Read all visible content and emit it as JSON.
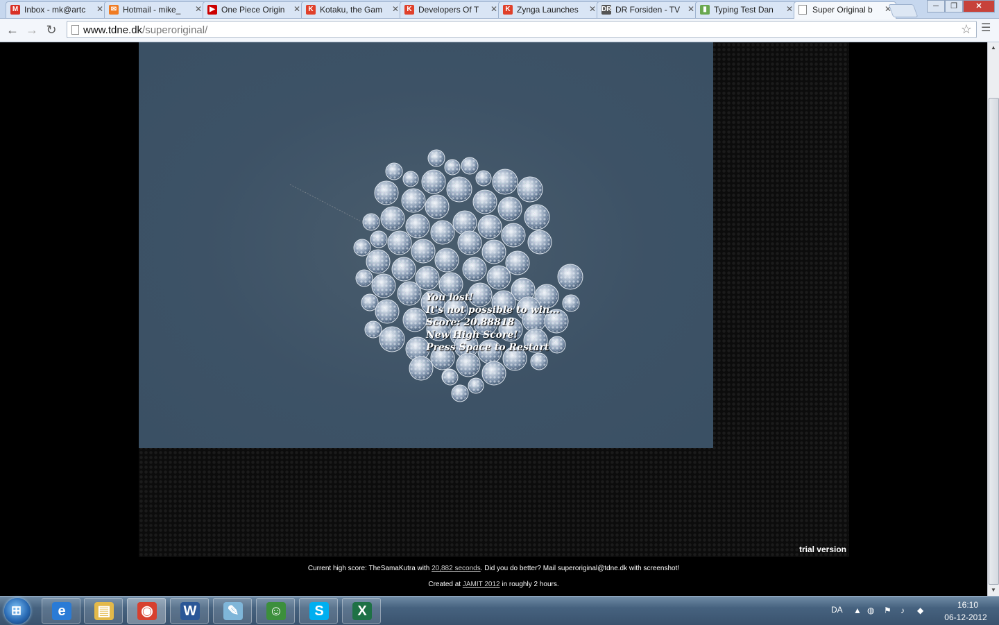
{
  "browser": {
    "tabs": [
      {
        "title": "Inbox - mk@artc",
        "icon": "gmail-icon",
        "color": "#d93025",
        "glyph": "M",
        "active": false
      },
      {
        "title": "Hotmail - mike_",
        "icon": "hotmail-icon",
        "color": "#f07b22",
        "glyph": "✉",
        "active": false
      },
      {
        "title": "One Piece Origin",
        "icon": "youtube-icon",
        "color": "#cc0000",
        "glyph": "▶",
        "active": false
      },
      {
        "title": "Kotaku, the Gam",
        "icon": "kotaku-icon",
        "color": "#e0402a",
        "glyph": "K",
        "active": false
      },
      {
        "title": "Developers Of T",
        "icon": "kotaku-icon",
        "color": "#e0402a",
        "glyph": "K",
        "active": false
      },
      {
        "title": "Zynga Launches",
        "icon": "kotaku-icon",
        "color": "#e0402a",
        "glyph": "K",
        "active": false
      },
      {
        "title": "DR Forsiden - TV",
        "icon": "dr-icon",
        "color": "#555555",
        "glyph": "DR",
        "active": false
      },
      {
        "title": "Typing Test Dan",
        "icon": "chart-icon",
        "color": "#6aa84f",
        "glyph": "▮",
        "active": false
      },
      {
        "title": "Super Original b",
        "icon": "page-icon",
        "color": "#ffffff",
        "glyph": "",
        "active": true
      }
    ],
    "window_buttons": {
      "minimize": "─",
      "maximize": "❐",
      "close": "✕"
    },
    "toolbar": {
      "back": "←",
      "forward": "→",
      "reload": "↻",
      "menu": "☰",
      "star": "☆"
    },
    "url": {
      "host": "www.tdne.dk",
      "path": "/superoriginal/"
    }
  },
  "game": {
    "overlay_lines": [
      "You lost!",
      "It's not possible to win...",
      "Score: 20.88818",
      "New High Score!",
      "Press Space to Restart"
    ],
    "colors": {
      "background": "#3d5266",
      "frame": "#0c0c0c"
    }
  },
  "page": {
    "trial_label": "trial version",
    "footer1": {
      "prefix": "Current high score: TheSamaKutra with ",
      "link": "20,882 seconds",
      "suffix": ". Did you do better? Mail superoriginal@tdne.dk with screenshot!"
    },
    "footer2": {
      "prefix": "Created at ",
      "link": "JAMIT 2012",
      "suffix": " in roughly 2 hours."
    }
  },
  "taskbar": {
    "start_glyph": "⊞",
    "apps": [
      {
        "name": "internet-explorer",
        "glyph": "e",
        "color": "#2a7bd6",
        "active": false
      },
      {
        "name": "file-explorer",
        "glyph": "▤",
        "color": "#e3b94a",
        "active": false
      },
      {
        "name": "chrome",
        "glyph": "◉",
        "color": "#d7402f",
        "active": true
      },
      {
        "name": "word",
        "glyph": "W",
        "color": "#2b5797",
        "active": false
      },
      {
        "name": "notes",
        "glyph": "✎",
        "color": "#7fb6d9",
        "active": false
      },
      {
        "name": "messenger",
        "glyph": "☺",
        "color": "#3c8f3c",
        "active": false
      },
      {
        "name": "skype",
        "glyph": "S",
        "color": "#00aff0",
        "active": false
      },
      {
        "name": "excel",
        "glyph": "X",
        "color": "#1e7145",
        "active": false
      }
    ],
    "tray": {
      "language": "DA",
      "time": "16:10",
      "date": "06-12-2012"
    }
  }
}
